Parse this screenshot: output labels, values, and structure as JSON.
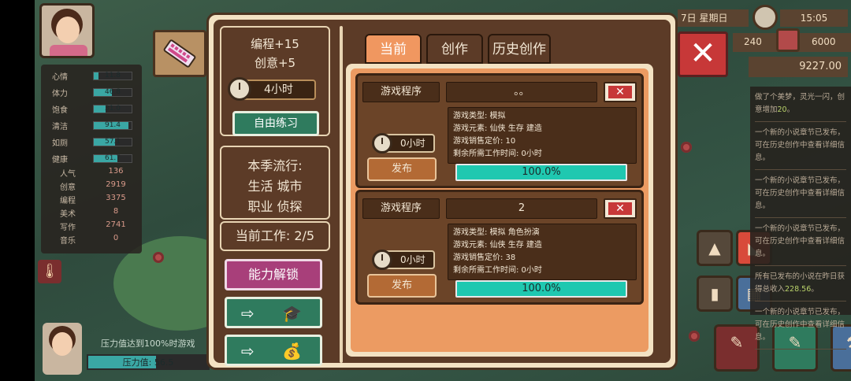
{
  "hud": {
    "stats": [
      {
        "label": "心情",
        "value": "11.8",
        "fill": 0.12
      },
      {
        "label": "体力",
        "value": "46.8",
        "fill": 0.47
      },
      {
        "label": "饱食",
        "value": "31.0",
        "fill": 0.31
      },
      {
        "label": "清洁",
        "value": "91.4",
        "fill": 0.91
      },
      {
        "label": "如厕",
        "value": "57.1",
        "fill": 0.57
      },
      {
        "label": "健康",
        "value": "61.7",
        "fill": 0.62
      }
    ],
    "attributes": [
      {
        "label": "人气",
        "value": "136"
      },
      {
        "label": "创意",
        "value": "2919"
      },
      {
        "label": "编程",
        "value": "3375"
      },
      {
        "label": "美术",
        "value": "8"
      },
      {
        "label": "写作",
        "value": "2741"
      },
      {
        "label": "音乐",
        "value": "0"
      }
    ],
    "stress_warning": "压力值达到100%时游戏",
    "stress_label": "压力值: 56.5",
    "stress_fill": 0.565
  },
  "top_bar": {
    "date": "7日  星期日",
    "time": "15:05",
    "res_a": "240",
    "res_b": "6000",
    "money": "9227.00"
  },
  "log": [
    {
      "text": "做了个美梦，灵光一闪，创意增加",
      "highlight": "20",
      "suffix": "。"
    },
    {
      "text": "一个新的小说章节已发布，可在历史创作中查看详细信息。"
    },
    {
      "text": "一个新的小说章节已发布，可在历史创作中查看详细信息。"
    },
    {
      "text": "一个新的小说章节已发布，可在历史创作中查看详细信息。"
    },
    {
      "text": "所有已发布的小说在昨日获得总收入",
      "highlight": "228.56",
      "suffix": "。"
    },
    {
      "text": "一个新的小说章节已发布，可在历史创作中查看详细信息。"
    }
  ],
  "panel": {
    "gain1": "编程+15",
    "gain2": "创意+5",
    "duration": "4小时",
    "free_practice": "自由练习",
    "trend_title": "本季流行:",
    "trend_line1": "生活  城市",
    "trend_line2": "职业  侦探",
    "current_work": "当前工作:  2/5",
    "unlock": "能力解锁",
    "arrow1_icon": "graduation-cap",
    "arrow2_icon": "coin-stack",
    "tabs": [
      "当前",
      "创作",
      "历史创作"
    ],
    "active_tab": "当前",
    "close_symbol": "✕"
  },
  "works": [
    {
      "type": "游戏程序",
      "name": "。。",
      "genre": "游戏类型:  模拟",
      "elements": "游戏元素:  仙侠 生存 建造",
      "price": "游戏销售定价:  10",
      "remaining": "剩余所需工作时间:  0小时",
      "duration": "0小时",
      "publish": "发布",
      "progress_label": "100.0%",
      "progress": 1.0
    },
    {
      "type": "游戏程序",
      "name": "2",
      "genre": "游戏类型:  模拟 角色扮演",
      "elements": "游戏元素:  仙侠 生存 建造",
      "price": "游戏销售定价:  38",
      "remaining": "剩余所需工作时间:  0小时",
      "duration": "0小时",
      "publish": "发布",
      "progress_label": "100.0%",
      "progress": 1.0
    }
  ],
  "colors": {
    "accent": "#f09760",
    "progress": "#1fc8b0",
    "close": "#c73838",
    "panel_bg": "#5c3b27"
  }
}
